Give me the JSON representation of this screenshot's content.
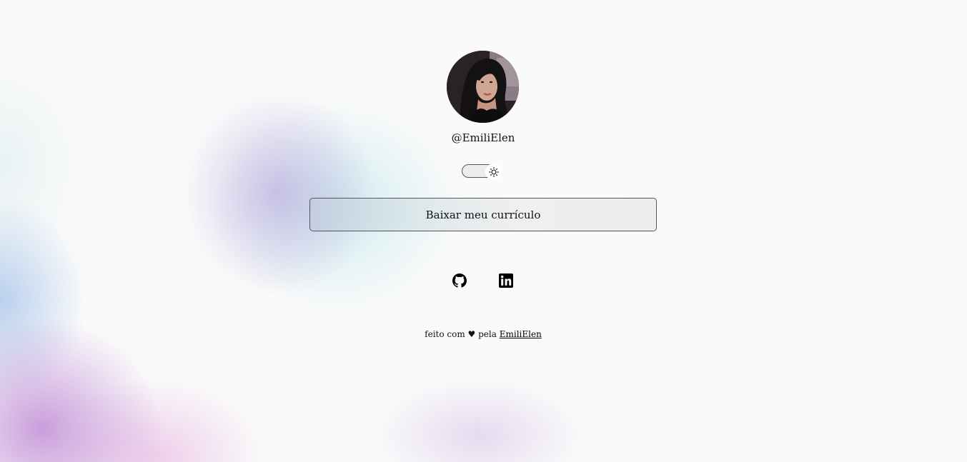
{
  "profile": {
    "username": "@EmiliElen"
  },
  "theme_toggle": {
    "icon": "sun-icon",
    "mode": "light"
  },
  "resume_button": {
    "label": "Baixar meu currículo"
  },
  "social_links": [
    {
      "name": "GitHub",
      "icon": "github-icon"
    },
    {
      "name": "LinkedIn",
      "icon": "linkedin-icon"
    }
  ],
  "footer": {
    "prefix": "feito com ♥ pela",
    "author": "EmiliElen"
  },
  "colors": {
    "background": "#fafafa",
    "blob_purple": "#b280d2",
    "blob_blue": "#96b9e6",
    "blob_cyan": "#afe1e8"
  }
}
